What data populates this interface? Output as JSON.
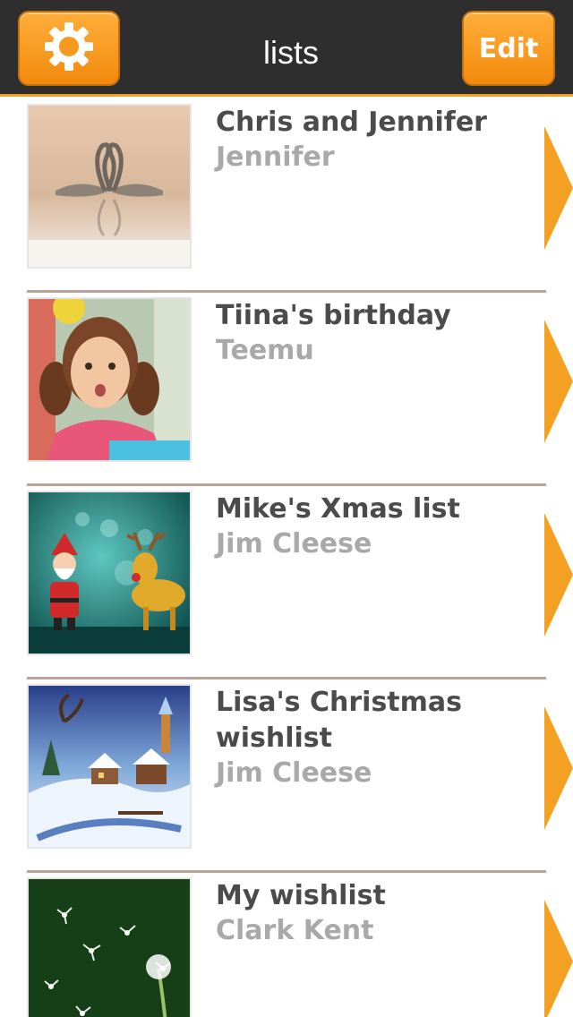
{
  "header": {
    "title": "lists",
    "edit_label": "Edit",
    "settings_icon": "gear-icon",
    "accent_color": "#f4a023"
  },
  "lists": [
    {
      "title": "Chris and Jennifer",
      "owner": "Jennifer",
      "thumbnail": "swans-photo"
    },
    {
      "title": "Tiina's birthday",
      "owner": "Teemu",
      "thumbnail": "girl-birthday-photo"
    },
    {
      "title": "Mike's Xmas list",
      "owner": "Jim Cleese",
      "thumbnail": "santa-reindeer-illustration"
    },
    {
      "title": "Lisa's Christmas wishlist",
      "owner": "Jim Cleese",
      "thumbnail": "winter-village-illustration"
    },
    {
      "title": "My wishlist",
      "owner": "Clark Kent",
      "thumbnail": "dandelion-photo"
    }
  ]
}
